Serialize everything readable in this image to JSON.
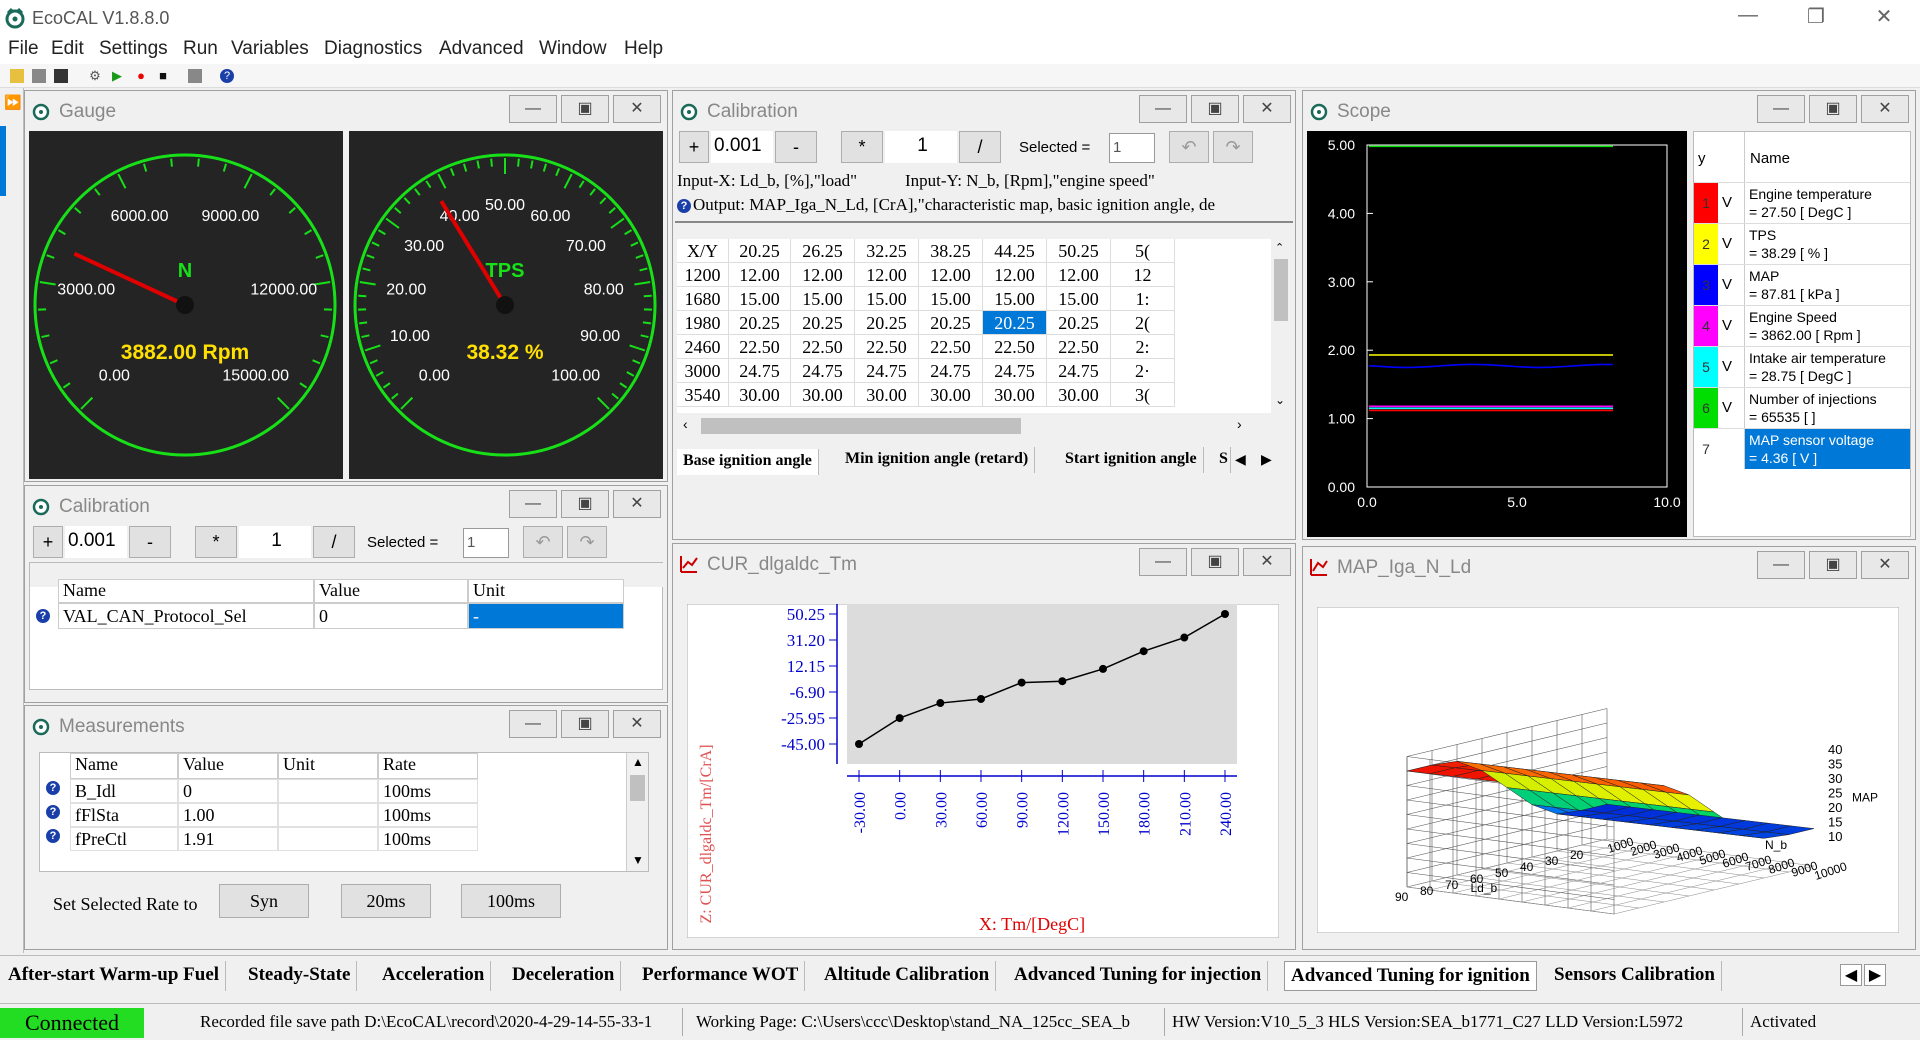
{
  "app": {
    "title": "EcoCAL V1.8.8.0"
  },
  "menu": [
    "File",
    "Edit",
    "Settings",
    "Run",
    "Variables",
    "Diagnostics",
    "Advanced",
    "Window",
    "Help"
  ],
  "gauge": {
    "title": "Gauge",
    "rpm": {
      "name": "N",
      "value": 3882.0,
      "value_text": "3882.00 Rpm",
      "max": 15000,
      "ticks": [
        "0.00",
        "3000.00",
        "6000.00",
        "9000.00",
        "12000.00",
        "15000.00"
      ]
    },
    "tps": {
      "name": "TPS",
      "value": 38.32,
      "value_text": "38.32 %",
      "max": 100,
      "ticks": [
        "0.00",
        "10.00",
        "20.00",
        "30.00",
        "40.00",
        "50.00",
        "60.00",
        "70.00",
        "80.00",
        "90.00",
        "100.00"
      ]
    }
  },
  "cal_small": {
    "title": "Calibration",
    "plus": "+",
    "step": "0.001",
    "minus": "-",
    "mul": "*",
    "factor": "1",
    "div": "/",
    "selected_label": "Selected =",
    "selected": "1",
    "headers": [
      "Name",
      "Value",
      "Unit"
    ],
    "row": {
      "name": "VAL_CAN_Protocol_Sel",
      "value": "0",
      "unit": "-"
    }
  },
  "measurements": {
    "title": "Measurements",
    "headers": [
      "Name",
      "Value",
      "Unit",
      "Rate"
    ],
    "rows": [
      {
        "name": "B_Idl",
        "value": "0",
        "unit": "",
        "rate": "100ms"
      },
      {
        "name": "fFlSta",
        "value": "1.00",
        "unit": "",
        "rate": "100ms"
      },
      {
        "name": "fPreCtl",
        "value": "1.91",
        "unit": "",
        "rate": "100ms"
      }
    ],
    "rate_label": "Set Selected Rate to",
    "rate_buttons": [
      "Syn",
      "20ms",
      "100ms"
    ]
  },
  "cal_map": {
    "title": "Calibration",
    "plus": "+",
    "step": "0.001",
    "minus": "-",
    "mul": "*",
    "factor": "1",
    "div": "/",
    "selected_label": "Selected =",
    "selected": "1",
    "input_x": "Input-X: Ld_b, [%],\"load\"",
    "input_y": "Input-Y: N_b, [Rpm],\"engine speed\"",
    "output": "Output: MAP_Iga_N_Ld, [CrA],\"characteristic map, basic ignition angle, de",
    "corner": "X/Y",
    "x": [
      "20.25",
      "26.25",
      "32.25",
      "38.25",
      "44.25",
      "50.25",
      "5("
    ],
    "rows": [
      {
        "y": "1200",
        "v": [
          "12.00",
          "12.00",
          "12.00",
          "12.00",
          "12.00",
          "12.00",
          "12"
        ]
      },
      {
        "y": "1680",
        "v": [
          "15.00",
          "15.00",
          "15.00",
          "15.00",
          "15.00",
          "15.00",
          "1:"
        ]
      },
      {
        "y": "1980",
        "v": [
          "20.25",
          "20.25",
          "20.25",
          "20.25",
          "20.25",
          "20.25",
          "2("
        ]
      },
      {
        "y": "2460",
        "v": [
          "22.50",
          "22.50",
          "22.50",
          "22.50",
          "22.50",
          "22.50",
          "2:"
        ]
      },
      {
        "y": "3000",
        "v": [
          "24.75",
          "24.75",
          "24.75",
          "24.75",
          "24.75",
          "24.75",
          "2·"
        ]
      },
      {
        "y": "3540",
        "v": [
          "30.00",
          "30.00",
          "30.00",
          "30.00",
          "30.00",
          "30.00",
          "3("
        ]
      }
    ],
    "tabs": [
      "Base ignition angle",
      "Min ignition angle (retard)",
      "Start ignition angle",
      "S"
    ]
  },
  "scope": {
    "title": "Scope",
    "yticks": [
      "5.00",
      "4.00",
      "3.00",
      "2.00",
      "1.00",
      "0.00"
    ],
    "xticks": [
      "0.0",
      "5.0",
      "10.0"
    ],
    "col_y": "y",
    "col_name": "Name",
    "signals": [
      {
        "idx": "1",
        "unit": "V",
        "name": "Engine temperature",
        "value": "= 27.50 [ DegC ]",
        "color": "#ff0000"
      },
      {
        "idx": "2",
        "unit": "V",
        "name": "TPS",
        "value": "= 38.29 [ % ]",
        "color": "#ffff00"
      },
      {
        "idx": "3",
        "unit": "V",
        "name": "MAP",
        "value": "= 87.81 [ kPa ]",
        "color": "#0000ff"
      },
      {
        "idx": "4",
        "unit": "V",
        "name": "Engine Speed",
        "value": "= 3862.00 [ Rpm ]",
        "color": "#ff00ff"
      },
      {
        "idx": "5",
        "unit": "V",
        "name": "Intake air temperature",
        "value": "= 28.75 [ DegC ]",
        "color": "#00ffff"
      },
      {
        "idx": "6",
        "unit": "V",
        "name": "Number of injections",
        "value": "= 65535 [ ]",
        "color": "#00dd00"
      },
      {
        "idx": "7",
        "unit": "",
        "name": "MAP sensor voltage",
        "value": "= 4.36 [ V ]",
        "color": "#ffffff"
      }
    ]
  },
  "curve": {
    "title": "CUR_dlgaldc_Tm",
    "ylabel": "Z: CUR_dlgaldc_Tm/[CrA]",
    "xlabel": "X: Tm/[DegC]",
    "yticks": [
      "50.25",
      "31.20",
      "12.15",
      "-6.90",
      "-25.95",
      "-45.00"
    ]
  },
  "chart_data": {
    "type": "line",
    "title": "CUR_dlgaldc_Tm",
    "xlabel": "X: Tm/[DegC]",
    "ylabel": "Z: CUR_dlgaldc_Tm/[CrA]",
    "x": [
      -30,
      0,
      30,
      60,
      90,
      120,
      150,
      180,
      210,
      240
    ],
    "values": [
      -45,
      -26,
      -15,
      -12,
      0,
      1,
      10,
      23,
      33,
      50.25
    ],
    "ylim": [
      -45,
      50.25
    ],
    "grid": false
  },
  "map3d": {
    "title": "MAP_Iga_N_Ld",
    "zticks": [
      "40",
      "35",
      "30",
      "25",
      "20",
      "15",
      "10"
    ],
    "zlabel": "MAP",
    "ld_ticks": [
      "90",
      "80",
      "70",
      "60",
      "50",
      "40",
      "30",
      "20"
    ],
    "ld_label": "Ld_b",
    "n_ticks": [
      "1000",
      "2000",
      "3000",
      "4000",
      "5000",
      "6000",
      "7000",
      "8000",
      "9000",
      "10000"
    ],
    "n_label": "N_b"
  },
  "bottom_tabs": [
    "After-start Warm-up Fuel",
    "Steady-State",
    "Acceleration",
    "Deceleration",
    "Performance WOT",
    "Altitude Calibration",
    "Advanced Tuning for injection",
    "Advanced Tuning for ignition",
    "Sensors Calibration"
  ],
  "status": {
    "connected": "Connected",
    "record": "Recorded file save path D:\\EcoCAL\\record\\2020-4-29-14-55-33-1",
    "working": "Working Page:  C:\\Users\\ccc\\Desktop\\stand_NA_125cc_SEA_b",
    "hw": "HW Version:V10_5_3 HLS Version:SEA_b1771_C27 LLD Version:L5972",
    "activated": "Activated"
  },
  "colors": {
    "accent": "#0078d7",
    "gauge_ring": "#18e018",
    "needle": "#e00000",
    "value_yellow": "#ffe000",
    "connected_bg": "#22dd22"
  }
}
